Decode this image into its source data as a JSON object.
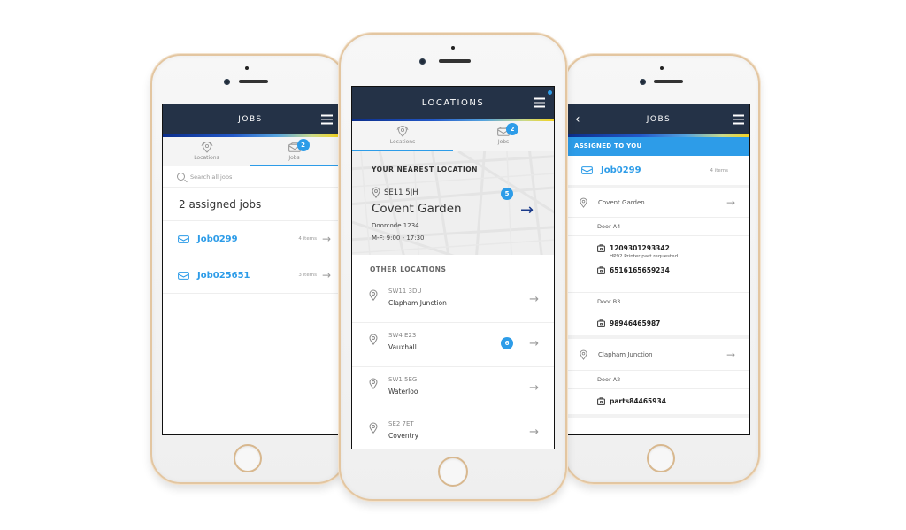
{
  "phones": {
    "left": {
      "header_title": "JOBS",
      "tabs": [
        {
          "label": "Locations",
          "icon": "location-pin-icon",
          "active": false
        },
        {
          "label": "Jobs",
          "icon": "envelope-icon",
          "active": true,
          "badge": "2"
        }
      ],
      "search_placeholder": "Search all jobs",
      "assigned_title": "2 assigned jobs",
      "jobs": [
        {
          "name": "Job0299",
          "count": "4 items"
        },
        {
          "name": "Job025651",
          "count": "3 items"
        }
      ]
    },
    "center": {
      "header_title": "LOCATIONS",
      "tabs": [
        {
          "label": "Locations",
          "icon": "location-pin-icon",
          "active": true
        },
        {
          "label": "Jobs",
          "icon": "envelope-icon",
          "active": false,
          "badge": "2"
        }
      ],
      "nearest": {
        "title": "YOUR NEAREST LOCATION",
        "postcode": "SE11 5JH",
        "name": "Covent Garden",
        "doorcode": "Doorcode 1234",
        "hours": "M-F: 9:00 - 17:30",
        "badge": "5"
      },
      "other_title": "OTHER LOCATIONS",
      "locations": [
        {
          "postcode": "SW11 3DU",
          "name": "Clapham Junction",
          "badge": ""
        },
        {
          "postcode": "SW4 E23",
          "name": "Vauxhall",
          "badge": "6"
        },
        {
          "postcode": "SW1 5EG",
          "name": "Waterloo",
          "badge": ""
        },
        {
          "postcode": "SE2 7ET",
          "name": "Coventry",
          "badge": ""
        }
      ]
    },
    "right": {
      "header_title": "JOBS",
      "banner": "ASSIGNED TO YOU",
      "job": {
        "name": "Job0299",
        "count": "4 items"
      },
      "locations": [
        {
          "name": "Covent Garden",
          "doors": [
            {
              "label": "Door A4",
              "parts": [
                {
                  "number": "1209301293342",
                  "note": "HP92 Printer part requested."
                },
                {
                  "number": "6516165659234",
                  "note": ""
                }
              ]
            },
            {
              "label": "Door B3",
              "parts": [
                {
                  "number": "98946465987",
                  "note": ""
                }
              ]
            }
          ]
        },
        {
          "name": "Clapham Junction",
          "doors": [
            {
              "label": "Door A2",
              "parts": [
                {
                  "number": "parts84465934",
                  "note": ""
                }
              ]
            }
          ]
        }
      ]
    }
  },
  "colors": {
    "header": "#243247",
    "accent": "#2d9ce8",
    "arrow_dark": "#1a3a8a",
    "frame_gold": "#e3c6a1"
  }
}
